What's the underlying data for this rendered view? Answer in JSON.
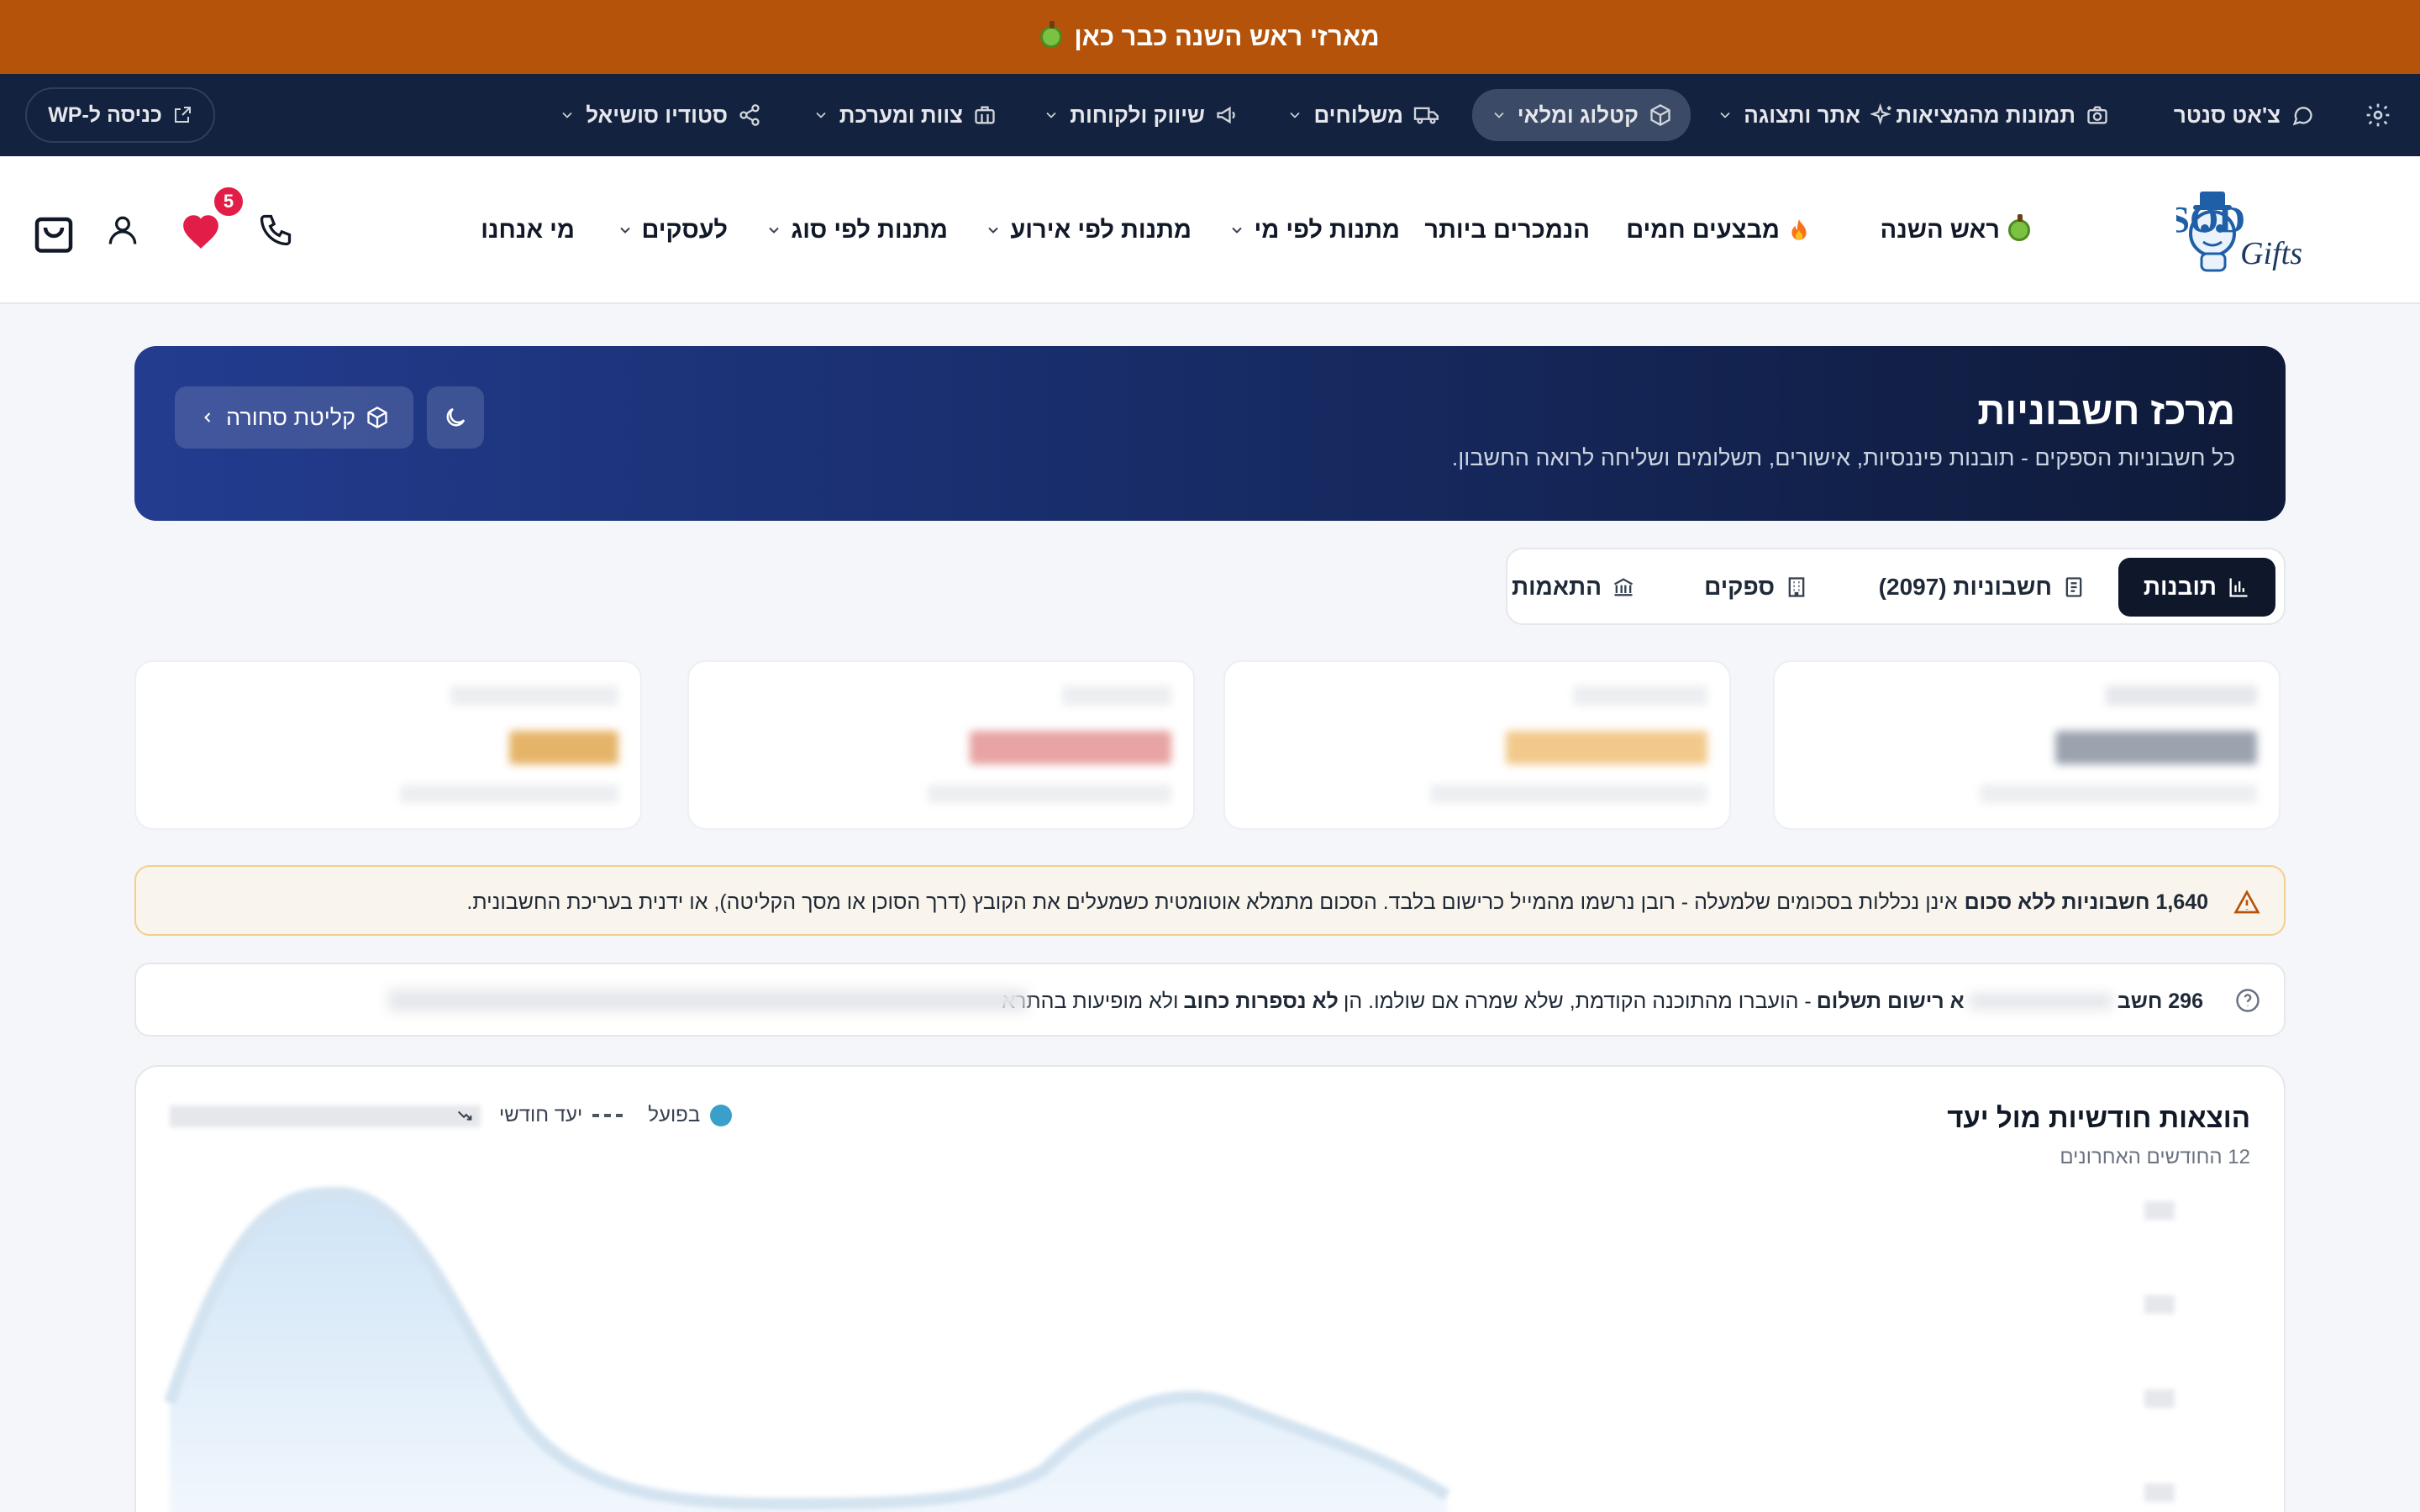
{
  "promo": {
    "text": "מארזי ראש השנה כבר כאן"
  },
  "adminbar": {
    "items": [
      {
        "label": "צ'אט סנטר",
        "icon": "chat-bubble-icon"
      },
      {
        "label": "תמונות מהמציאות",
        "icon": "camera-icon"
      },
      {
        "label": "אתר ותצוגה",
        "icon": "sparkles-icon"
      },
      {
        "label": "קטלוג ומלאי",
        "icon": "box-icon",
        "active": true
      },
      {
        "label": "משלוחים",
        "icon": "truck-icon"
      },
      {
        "label": "שיווק ולקוחות",
        "icon": "megaphone-icon"
      },
      {
        "label": "צוות ומערכת",
        "icon": "briefcase-icon"
      },
      {
        "label": "סטודיו סושיאל",
        "icon": "share-icon"
      }
    ],
    "wp_login": "כניסה ל-WP"
  },
  "mainnav": {
    "logo": {
      "brand": "HASOD",
      "script": "Gifts"
    },
    "items": [
      {
        "label": "ראש השנה",
        "icon": "apple-icon"
      },
      {
        "label": "מבצעים חמים",
        "icon": "fire-icon"
      },
      {
        "label": "הנמכרים ביותר"
      },
      {
        "label": "מתנות לפי מי",
        "dropdown": true
      },
      {
        "label": "מתנות לפי אירוע",
        "dropdown": true
      },
      {
        "label": "מתנות לפי סוג",
        "dropdown": true
      },
      {
        "label": "לעסקים",
        "dropdown": true
      },
      {
        "label": "מי אנחנו"
      }
    ],
    "wishlist_count": "5"
  },
  "hero": {
    "title": "מרכז חשבוניות",
    "subtitle": "כל חשבוניות הספקים - תובנות פיננסיות, אישורים, תשלומים ושליחה לרואה החשבון.",
    "receive_button": "קליטת סחורה"
  },
  "tabs": [
    {
      "label": "תובנות",
      "icon": "bar-chart-icon",
      "active": true
    },
    {
      "label": "חשבוניות (2097)",
      "icon": "document-icon"
    },
    {
      "label": "ספקים",
      "icon": "building-icon"
    },
    {
      "label": "התאמות",
      "icon": "bank-icon"
    }
  ],
  "warning": {
    "bold": "1,640 חשבוניות ללא סכום",
    "text": "אינן נכללות בסכומים שלמעלה - רובן נרשמו מהמייל כרישום בלבד. הסכום מתמלא אוטומטית כשמעלים את הקובץ (דרך הסוכן או מסך הקליטה), או ידנית בעריכת החשבונית."
  },
  "info": {
    "count": "296 חשב",
    "bold1": "א רישום תשלום",
    "text1": "- הועברו מהתוכנה הקודמת, שלא שמרה אם שולמו. הן",
    "bold2": "לא נספרות כחוב",
    "text2": "ולא מופיעות בהתרא"
  },
  "chart": {
    "title": "הוצאות חודשיות מול יעד",
    "subtitle": "12 החודשים האחרונים",
    "legend_actual": "בפועל",
    "legend_target": "יעד חודשי",
    "colors": {
      "actual": "#3aa0c9",
      "fill": "#dcebf8"
    }
  }
}
